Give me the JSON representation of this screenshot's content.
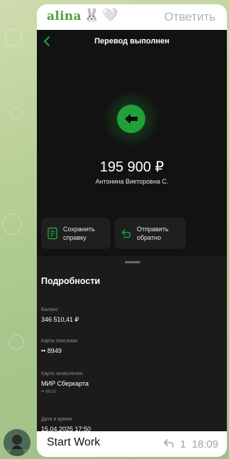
{
  "chat": {
    "sender": "alina",
    "sender_emojis": [
      "🐰",
      "🤍"
    ],
    "reply_label": "Ответить",
    "caption": "Start Work",
    "forward_count": "1",
    "time": "18:09"
  },
  "transfer": {
    "header_title": "Перевод выполнен",
    "amount": "195 900 ₽",
    "recipient": "Антонина Викторовна С.",
    "status_color": "#21a038",
    "actions": [
      {
        "label_line1": "Сохранить",
        "label_line2": "справку",
        "icon": "document-icon"
      },
      {
        "label_line1": "Отправить",
        "label_line2": "обратно",
        "icon": "return-arrow-icon"
      }
    ],
    "details": {
      "title": "Подробности",
      "fields": [
        {
          "label": "Баланс",
          "value": "346 510,41 ₽",
          "sub": ""
        },
        {
          "label": "Карта списания",
          "value": "•• 8949",
          "sub": ""
        },
        {
          "label": "Карта зачисления",
          "value": "МИР Сберкарта",
          "sub": "•• 8818"
        },
        {
          "label": "Дата и время",
          "value": "15.04.2025 17:50",
          "sub": ""
        }
      ]
    }
  }
}
